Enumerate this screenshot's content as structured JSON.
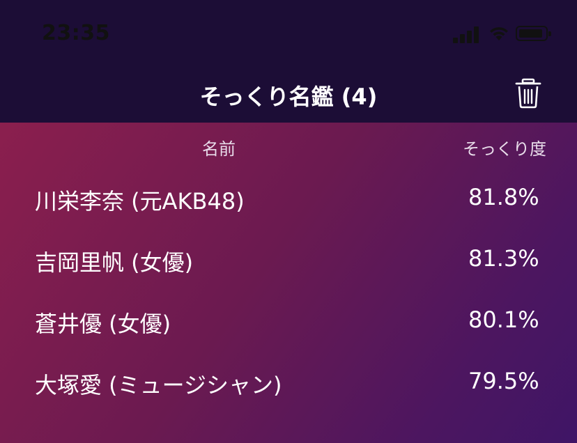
{
  "status_bar": {
    "time": "23:35"
  },
  "nav": {
    "title": "そっくり名鑑 (4)",
    "trash_icon": "trash-icon"
  },
  "table": {
    "headers": {
      "name": "名前",
      "score": "そっくり度"
    },
    "rows": [
      {
        "name": "川栄李奈 (元AKB48)",
        "score": "81.8%"
      },
      {
        "name": "吉岡里帆 (女優)",
        "score": "81.3%"
      },
      {
        "name": "蒼井優 (女優)",
        "score": "80.1%"
      },
      {
        "name": "大塚愛 (ミュージシャン)",
        "score": "79.5%"
      }
    ]
  },
  "colors": {
    "top_bar": "#1c0d36",
    "gradient_start": "#8b1f4e",
    "gradient_end": "#3f1566",
    "text": "#ffffff"
  }
}
